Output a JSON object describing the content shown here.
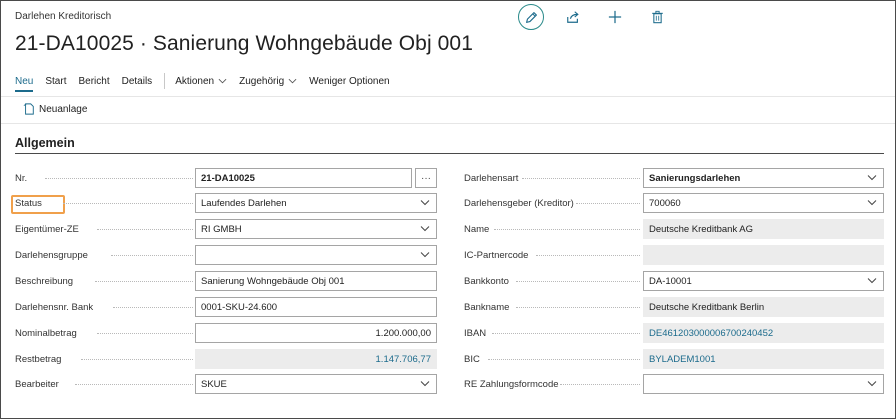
{
  "header": {
    "page_type": "Darlehen Kreditorisch",
    "title": "21-DA10025 · Sanierung Wohngebäude Obj 001",
    "top_icons": [
      "edit-icon",
      "share-icon",
      "add-icon",
      "delete-icon"
    ]
  },
  "action_bar": {
    "items": [
      {
        "label": "Neu",
        "active": true
      },
      {
        "label": "Start"
      },
      {
        "label": "Bericht"
      },
      {
        "label": "Details"
      }
    ],
    "menus": [
      {
        "label": "Aktionen",
        "chevron": true
      },
      {
        "label": "Zugehörig",
        "chevron": true
      },
      {
        "label": "Weniger Optionen"
      }
    ]
  },
  "sub_bar": {
    "new_label": "Neuanlage"
  },
  "section": {
    "title": "Allgemein"
  },
  "left_fields": [
    {
      "label": "Nr.",
      "value": "21-DA10025",
      "type": "text-assist",
      "bold": true
    },
    {
      "label": "Status",
      "value": "Laufendes Darlehen",
      "type": "select"
    },
    {
      "label": "Eigentümer-ZE",
      "value": "RI GMBH",
      "type": "select"
    },
    {
      "label": "Darlehensgruppe",
      "value": "",
      "type": "select"
    },
    {
      "label": "Beschreibung",
      "value": "Sanierung Wohngebäude Obj 001",
      "type": "text"
    },
    {
      "label": "Darlehensnr. Bank",
      "value": "0001-SKU-24.600",
      "type": "text"
    },
    {
      "label": "Nominalbetrag",
      "value": "1.200.000,00",
      "type": "number"
    },
    {
      "label": "Restbetrag",
      "value": "1.147.706,77",
      "type": "readonly-number"
    },
    {
      "label": "Bearbeiter",
      "value": "SKUE",
      "type": "select"
    }
  ],
  "right_fields": [
    {
      "label": "Darlehensart",
      "value": "Sanierungsdarlehen",
      "type": "select",
      "bold": true
    },
    {
      "label": "Darlehensgeber (Kreditor)",
      "value": "700060",
      "type": "select"
    },
    {
      "label": "Name",
      "value": "Deutsche Kreditbank AG",
      "type": "readonly"
    },
    {
      "label": "IC-Partnercode",
      "value": "",
      "type": "readonly"
    },
    {
      "label": "Bankkonto",
      "value": "DA-10001",
      "type": "select"
    },
    {
      "label": "Bankname",
      "value": "Deutsche Kreditbank Berlin",
      "type": "readonly"
    },
    {
      "label": "IBAN",
      "value": "DE46120300000670024045 2",
      "type": "readonly-link"
    },
    {
      "label": "BIC",
      "value": "BYLADEM1001",
      "type": "readonly-link"
    },
    {
      "label": "RE Zahlungsformcode",
      "value": "",
      "type": "select"
    }
  ],
  "colors": {
    "accent": "#1c6b8c",
    "highlight": "#f0a04b",
    "readonly_bg": "#ececec"
  }
}
